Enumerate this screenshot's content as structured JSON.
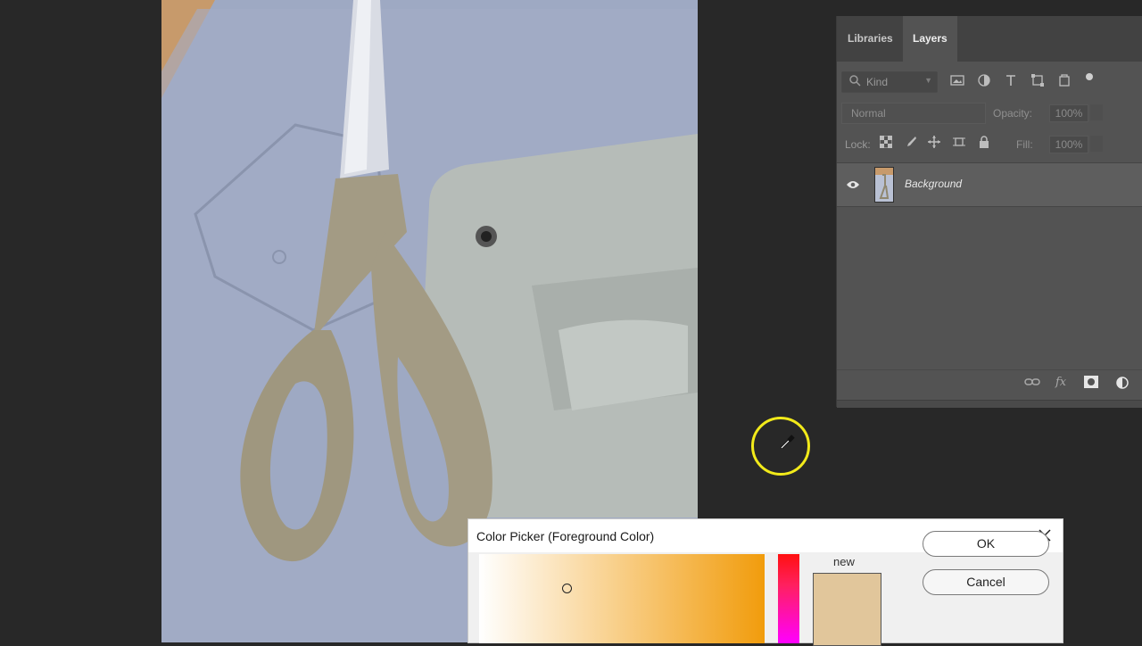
{
  "layers_panel": {
    "tabs": [
      {
        "label": "Libraries",
        "active": false
      },
      {
        "label": "Layers",
        "active": true
      }
    ],
    "filter": {
      "kind_placeholder": "Kind"
    },
    "blend_mode": "Normal",
    "opacity_label": "Opacity:",
    "opacity_value": "100%",
    "lock_label": "Lock:",
    "fill_label": "Fill:",
    "fill_value": "100%",
    "layers": [
      {
        "name": "Background",
        "visible": true
      }
    ],
    "bottom_icons": [
      "link-icon",
      "fx-icon",
      "mask-icon",
      "adjustment-icon"
    ]
  },
  "color_picker": {
    "title": "Color Picker (Foreground Color)",
    "ok_label": "OK",
    "cancel_label": "Cancel",
    "new_label": "new",
    "new_color": "#e1c69b",
    "hue_color": "#f19c0c"
  },
  "cursor": {
    "tool": "eyedropper-icon",
    "highlight_color": "#f2ea1a"
  }
}
